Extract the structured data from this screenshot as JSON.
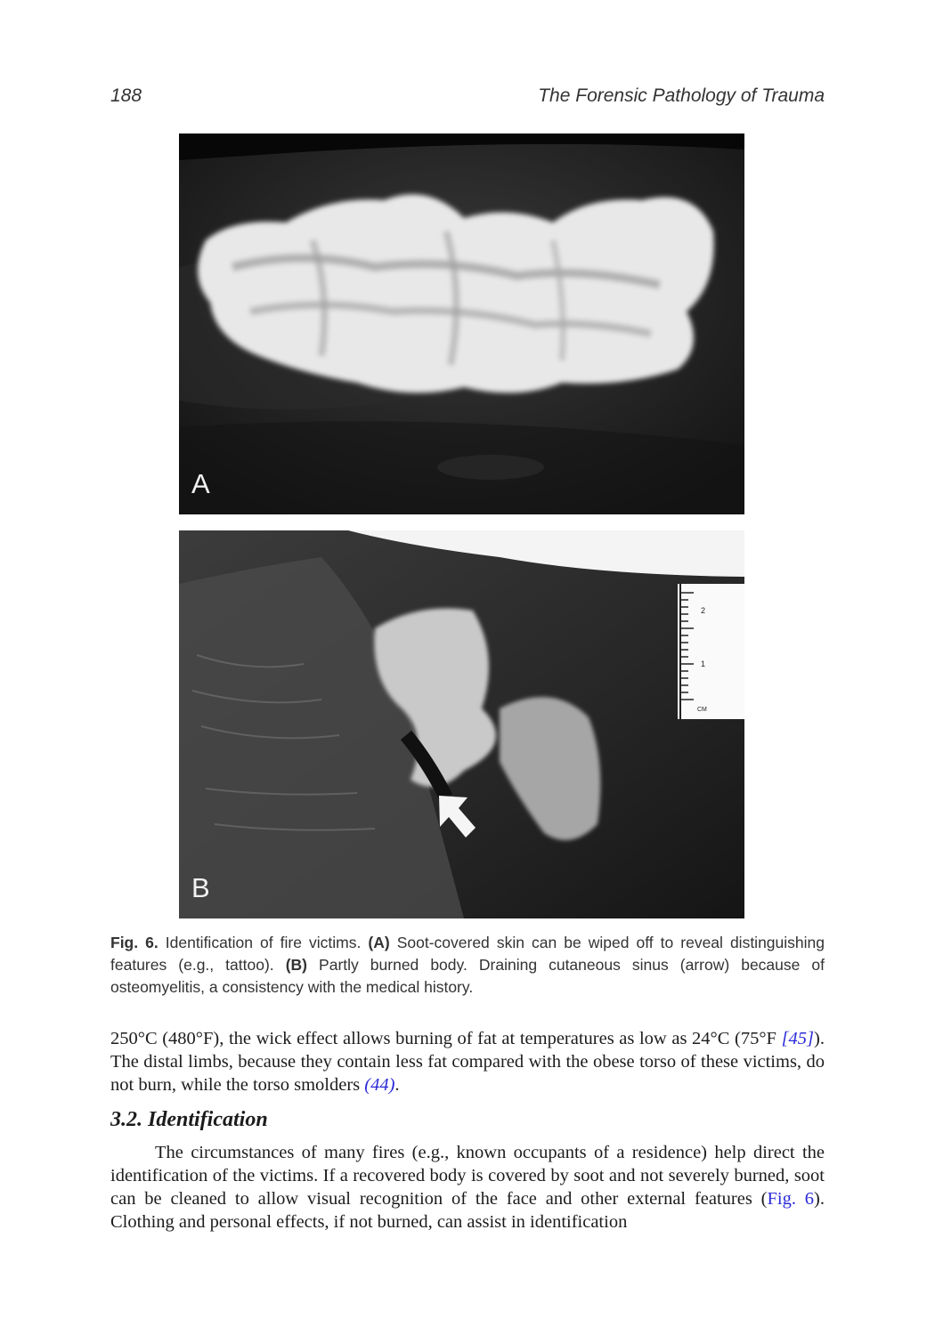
{
  "header": {
    "page_number": "188",
    "running_title": "The Forensic Pathology of Trauma"
  },
  "figure": {
    "panel_a_label": "A",
    "panel_b_label": "B",
    "ruler_marks": [
      "2",
      "1",
      "CM"
    ],
    "caption": {
      "label": "Fig. 6.",
      "intro": " Identification of fire victims. ",
      "a_tag": "(A)",
      "a_text": " Soot-covered skin can be wiped off to reveal distinguishing features (e.g., tattoo). ",
      "b_tag": "(B)",
      "b_text": " Partly burned body. Draining cutaneous sinus (arrow) because of osteomyelitis, a consistency with the medical history."
    }
  },
  "paragraph1": {
    "t1": "250°C (480°F), the wick effect allows burning of fat at temperatures as low as 24°C (75°F ",
    "cite45": "[45]",
    "t2": "). The distal limbs, because they contain less fat compared with the obese torso of these victims, do not burn, while the torso smolders ",
    "cite44": "(44)",
    "t3": "."
  },
  "section": {
    "heading": "3.2. Identification"
  },
  "paragraph2": {
    "t1": "The circumstances of many fires (e.g., known occupants of a residence) help direct the identification of the victims. If a recovered body is covered by soot and not severely burned, soot can be cleaned to allow visual recognition of the face and other external features (",
    "figref": "Fig. 6",
    "t2": "). Clothing and personal effects, if not burned, can assist in identification"
  }
}
